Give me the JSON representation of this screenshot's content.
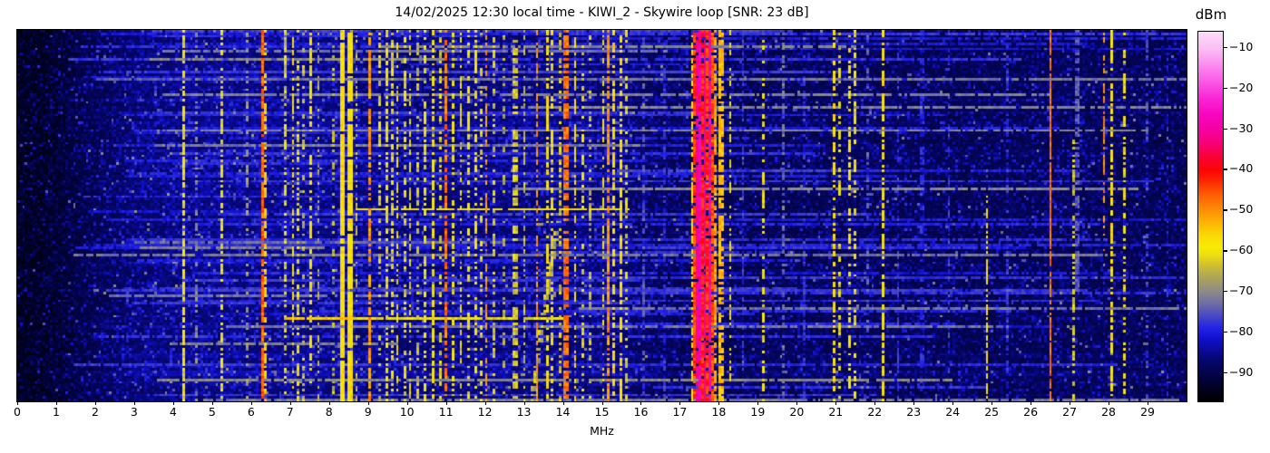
{
  "chart_data": {
    "type": "heatmap",
    "subtype": "radio-spectrum-waterfall",
    "title": "14/02/2025 12:30 local time - KIWI_2 - Skywire loop [SNR: 23 dB]",
    "xlabel": "MHz",
    "x_range": [
      0,
      30
    ],
    "x_ticks": [
      "0",
      "1",
      "2",
      "3",
      "4",
      "5",
      "6",
      "7",
      "8",
      "9",
      "10",
      "11",
      "12",
      "13",
      "14",
      "15",
      "16",
      "17",
      "18",
      "19",
      "20",
      "21",
      "22",
      "23",
      "24",
      "25",
      "26",
      "27",
      "28",
      "29"
    ],
    "grid": false,
    "colorbar": {
      "title": "dBm",
      "vmin": -97,
      "vmax": -6,
      "ticks": [
        {
          "v": -10,
          "label": "−10"
        },
        {
          "v": -20,
          "label": "−20"
        },
        {
          "v": -30,
          "label": "−30"
        },
        {
          "v": -40,
          "label": "−40"
        },
        {
          "v": -50,
          "label": "−50"
        },
        {
          "v": -60,
          "label": "−60"
        },
        {
          "v": -70,
          "label": "−70"
        },
        {
          "v": -80,
          "label": "−80"
        },
        {
          "v": -90,
          "label": "−90"
        }
      ],
      "stops": [
        [
          -97,
          "#000000"
        ],
        [
          -92,
          "#020238"
        ],
        [
          -87,
          "#06066e"
        ],
        [
          -82,
          "#0f0fc8"
        ],
        [
          -79,
          "#2323e6"
        ],
        [
          -76,
          "#4949c6"
        ],
        [
          -73,
          "#6e6ea6"
        ],
        [
          -70,
          "#8d8c88"
        ],
        [
          -67,
          "#a9a160"
        ],
        [
          -64,
          "#c8bb38"
        ],
        [
          -61,
          "#eddf10"
        ],
        [
          -59,
          "#f7ec06"
        ],
        [
          -56,
          "#fbd805"
        ],
        [
          -53,
          "#fdb405"
        ],
        [
          -50,
          "#fd8f04"
        ],
        [
          -46,
          "#fd5c03"
        ],
        [
          -42,
          "#fc1c04"
        ],
        [
          -40,
          "#fc0505"
        ],
        [
          -37,
          "#f80233"
        ],
        [
          -33,
          "#f6017e"
        ],
        [
          -30,
          "#f401a2"
        ],
        [
          -26,
          "#f807c2"
        ],
        [
          -22,
          "#fa2ad8"
        ],
        [
          -18,
          "#fb5ce8"
        ],
        [
          -14,
          "#fb8eee"
        ],
        [
          -10,
          "#fbc0f4"
        ],
        [
          -6,
          "#fcdcfa"
        ]
      ]
    },
    "spectrogram": {
      "cols": 460,
      "rows": 146,
      "seed": 1337,
      "floor": -96,
      "speckle_mean": 3.2,
      "noise_profile": [
        [
          0,
          0
        ],
        [
          0.8,
          1
        ],
        [
          1.8,
          4
        ],
        [
          3,
          7
        ],
        [
          4.5,
          8
        ],
        [
          8,
          8
        ],
        [
          10,
          7
        ],
        [
          13,
          7.5
        ],
        [
          15.6,
          6.5
        ],
        [
          17,
          5
        ],
        [
          19,
          4.6
        ],
        [
          22,
          5
        ],
        [
          24,
          4.6
        ],
        [
          27,
          5
        ],
        [
          30,
          4.4
        ]
      ],
      "random_hlines": {
        "count": 85,
        "seed": 77
      },
      "stripe_fields": "f_mhz,width_cells,level_dbm,duty,y0,y1",
      "stripes": [
        [
          4.28,
          1,
          -60,
          0.7,
          0,
          1
        ],
        [
          4.62,
          1,
          -70,
          0.4,
          0,
          1
        ],
        [
          5.26,
          1,
          -60,
          0.6,
          0,
          1
        ],
        [
          5.92,
          1,
          -68,
          0.35,
          0,
          1
        ],
        [
          6.27,
          1,
          -47,
          0.85,
          0,
          1
        ],
        [
          6.38,
          1,
          -56,
          0.55,
          0,
          1
        ],
        [
          6.9,
          1,
          -62,
          0.5,
          0,
          1
        ],
        [
          7.05,
          1,
          -59,
          0.55,
          0,
          1
        ],
        [
          7.2,
          1,
          -61,
          0.5,
          0,
          1
        ],
        [
          7.35,
          1,
          -64,
          0.4,
          0,
          1
        ],
        [
          7.5,
          1,
          -59,
          0.5,
          0,
          1
        ],
        [
          7.72,
          1,
          -66,
          0.35,
          0,
          1
        ],
        [
          8.1,
          1,
          -64,
          0.35,
          0,
          1
        ],
        [
          8.38,
          2,
          -57,
          0.95,
          0,
          1
        ],
        [
          8.53,
          2,
          -58,
          0.9,
          0,
          1
        ],
        [
          8.68,
          1,
          -64,
          0.4,
          0,
          1
        ],
        [
          9.05,
          1,
          -51,
          0.7,
          0,
          1
        ],
        [
          9.28,
          1,
          -63,
          0.4,
          0,
          1
        ],
        [
          9.47,
          1,
          -60,
          0.55,
          0,
          1
        ],
        [
          9.62,
          1,
          -61,
          0.5,
          0,
          1
        ],
        [
          9.78,
          1,
          -60,
          0.55,
          0,
          1
        ],
        [
          9.92,
          1,
          -62,
          0.45,
          0,
          1
        ],
        [
          10.05,
          1,
          -61,
          0.5,
          0,
          1
        ],
        [
          10.25,
          1,
          -64,
          0.4,
          0,
          1
        ],
        [
          10.45,
          1,
          -60,
          0.5,
          0,
          1
        ],
        [
          10.65,
          1,
          -59,
          0.55,
          0,
          1
        ],
        [
          10.85,
          1,
          -62,
          0.45,
          0,
          1
        ],
        [
          11.0,
          1,
          -48,
          0.7,
          0,
          1
        ],
        [
          11.18,
          1,
          -60,
          0.5,
          0,
          1
        ],
        [
          11.35,
          1,
          -61,
          0.5,
          0,
          1
        ],
        [
          11.55,
          1,
          -60,
          0.5,
          0,
          1
        ],
        [
          11.75,
          1,
          -59,
          0.55,
          0,
          1
        ],
        [
          11.9,
          1,
          -62,
          0.4,
          0,
          1
        ],
        [
          12.05,
          1,
          -51,
          0.6,
          0,
          1
        ],
        [
          12.2,
          1,
          -63,
          0.4,
          0,
          1
        ],
        [
          12.5,
          1,
          -66,
          0.3,
          0,
          1
        ],
        [
          12.75,
          2,
          -63,
          0.5,
          0,
          1
        ],
        [
          13.0,
          1,
          -64,
          0.4,
          0,
          1
        ],
        [
          13.35,
          1,
          -51,
          0.6,
          0,
          1
        ],
        [
          13.58,
          1,
          -58,
          0.55,
          0,
          1
        ],
        [
          13.72,
          1,
          -60,
          0.5,
          0,
          1
        ],
        [
          13.9,
          1,
          -63,
          0.4,
          0,
          1
        ],
        [
          14.1,
          2,
          -48,
          0.65,
          0,
          1
        ],
        [
          14.32,
          1,
          -58,
          0.5,
          0,
          1
        ],
        [
          14.48,
          1,
          -61,
          0.45,
          0,
          1
        ],
        [
          14.7,
          1,
          -65,
          0.35,
          0,
          1
        ],
        [
          15.0,
          1,
          -60,
          0.5,
          0,
          1
        ],
        [
          15.15,
          1,
          -50,
          0.75,
          0,
          1
        ],
        [
          15.32,
          1,
          -57,
          0.6,
          0,
          1
        ],
        [
          15.47,
          1,
          -59,
          0.55,
          0,
          1
        ],
        [
          15.62,
          1,
          -62,
          0.4,
          0,
          1
        ],
        [
          16.1,
          1,
          -76,
          0.5,
          0,
          1
        ],
        [
          16.6,
          1,
          -79,
          0.5,
          0,
          1
        ],
        [
          17.32,
          1,
          -58,
          0.6,
          0,
          1
        ],
        [
          17.38,
          1,
          -44,
          0.85,
          0,
          1
        ],
        [
          17.44,
          1,
          -30,
          0.9,
          0,
          1
        ],
        [
          17.5,
          1,
          -40,
          0.85,
          0,
          1
        ],
        [
          17.53,
          1,
          -29,
          0.9,
          0,
          1
        ],
        [
          17.59,
          1,
          -42,
          0.85,
          0,
          1
        ],
        [
          17.65,
          1,
          -31,
          0.9,
          0,
          1
        ],
        [
          17.71,
          1,
          -43,
          0.85,
          0,
          1
        ],
        [
          17.77,
          1,
          -28,
          0.9,
          0,
          1
        ],
        [
          17.82,
          1,
          -45,
          0.8,
          0,
          1
        ],
        [
          17.88,
          1,
          -52,
          0.7,
          0,
          1
        ],
        [
          18.0,
          1,
          -56,
          0.5,
          0,
          1
        ],
        [
          18.09,
          2,
          -54,
          0.55,
          0,
          1
        ],
        [
          18.28,
          1,
          -59,
          0.4,
          0,
          1
        ],
        [
          18.6,
          1,
          -78,
          0.5,
          0,
          1
        ],
        [
          19.12,
          1,
          -60,
          0.45,
          0,
          1
        ],
        [
          19.65,
          1,
          -73,
          0.4,
          0,
          1
        ],
        [
          20.2,
          1,
          -79,
          0.5,
          0,
          1
        ],
        [
          20.95,
          1,
          -58,
          0.55,
          0,
          1
        ],
        [
          21.12,
          1,
          -62,
          0.45,
          0,
          1
        ],
        [
          21.35,
          1,
          -58,
          0.55,
          0,
          1
        ],
        [
          21.52,
          1,
          -60,
          0.5,
          0,
          1
        ],
        [
          21.8,
          1,
          -75,
          0.35,
          0,
          1
        ],
        [
          22.2,
          1,
          -58,
          0.7,
          0,
          1
        ],
        [
          22.6,
          1,
          -78,
          0.4,
          0,
          1
        ],
        [
          23.2,
          2,
          -80,
          0.5,
          0,
          1
        ],
        [
          23.9,
          1,
          -77,
          0.4,
          0,
          1
        ],
        [
          24.86,
          1,
          -58,
          0.7,
          0.45,
          1
        ],
        [
          25.4,
          1,
          -79,
          0.5,
          0,
          1
        ],
        [
          26.5,
          1,
          -48,
          0.85,
          0,
          1
        ],
        [
          27.1,
          1,
          -63,
          0.5,
          0.3,
          1
        ],
        [
          27.22,
          2,
          -75,
          0.55,
          0,
          0.7
        ],
        [
          27.9,
          1,
          -50,
          0.55,
          0,
          0.6
        ],
        [
          28.05,
          1,
          -58,
          0.6,
          0,
          1
        ],
        [
          28.4,
          1,
          -60,
          0.45,
          0,
          1
        ],
        [
          29.0,
          1,
          -77,
          0.4,
          0,
          1
        ],
        [
          29.5,
          1,
          -80,
          0.4,
          0,
          1
        ]
      ],
      "hline_fields": "y_frac,f0_mhz,f1_mhz,level_dbm",
      "hlines": [
        [
          0.48,
          8.7,
          15.7,
          -59
        ],
        [
          0.78,
          6.9,
          8.6,
          -55
        ],
        [
          0.78,
          8.6,
          14.0,
          -61
        ],
        [
          0.31,
          3.5,
          16.0,
          -72
        ],
        [
          0.13,
          2.0,
          10.5,
          -75
        ],
        [
          0.57,
          3.0,
          12.5,
          -74
        ]
      ],
      "diagonal_fields": "f0_mhz,y0_frac,f1_mhz,y1_frac,level_dbm,duty",
      "diagonals": [
        [
          13.15,
          1.0,
          13.8,
          0.52,
          -64,
          0.75
        ]
      ]
    }
  }
}
